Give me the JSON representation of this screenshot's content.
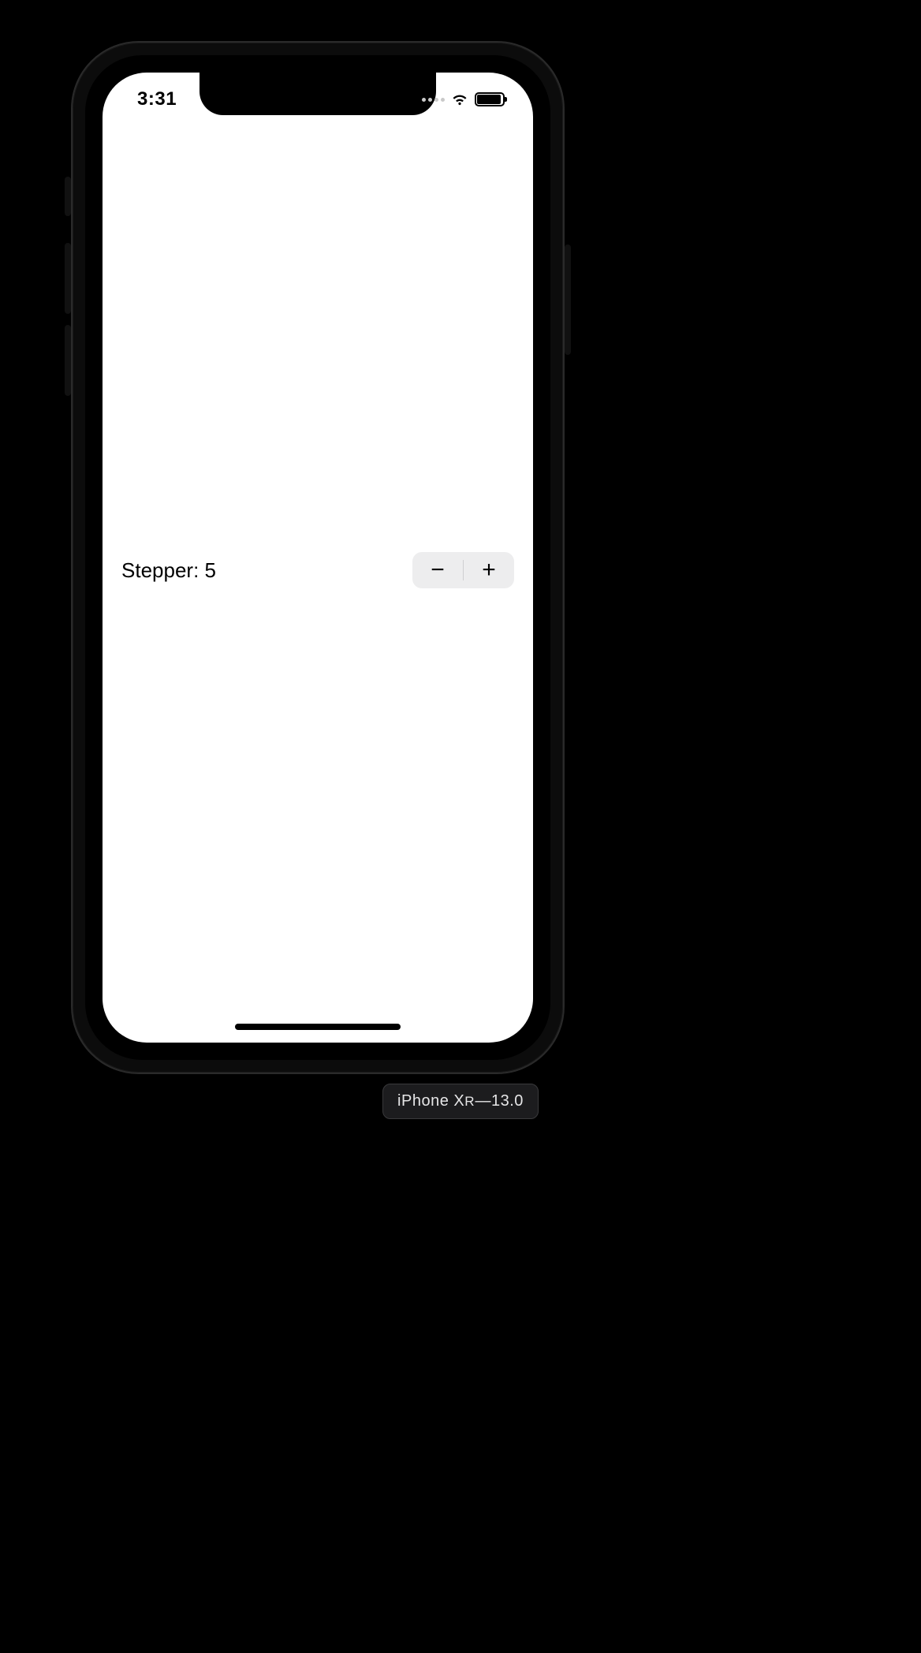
{
  "status_bar": {
    "time": "3:31"
  },
  "content": {
    "stepper": {
      "label_prefix": "Stepper: ",
      "value": 5,
      "minus_glyph": "−",
      "plus_glyph": "+"
    }
  },
  "device_label": {
    "model_prefix": "iPhone X",
    "model_suffix": "R",
    "separator": " — ",
    "os_version": "13.0"
  }
}
